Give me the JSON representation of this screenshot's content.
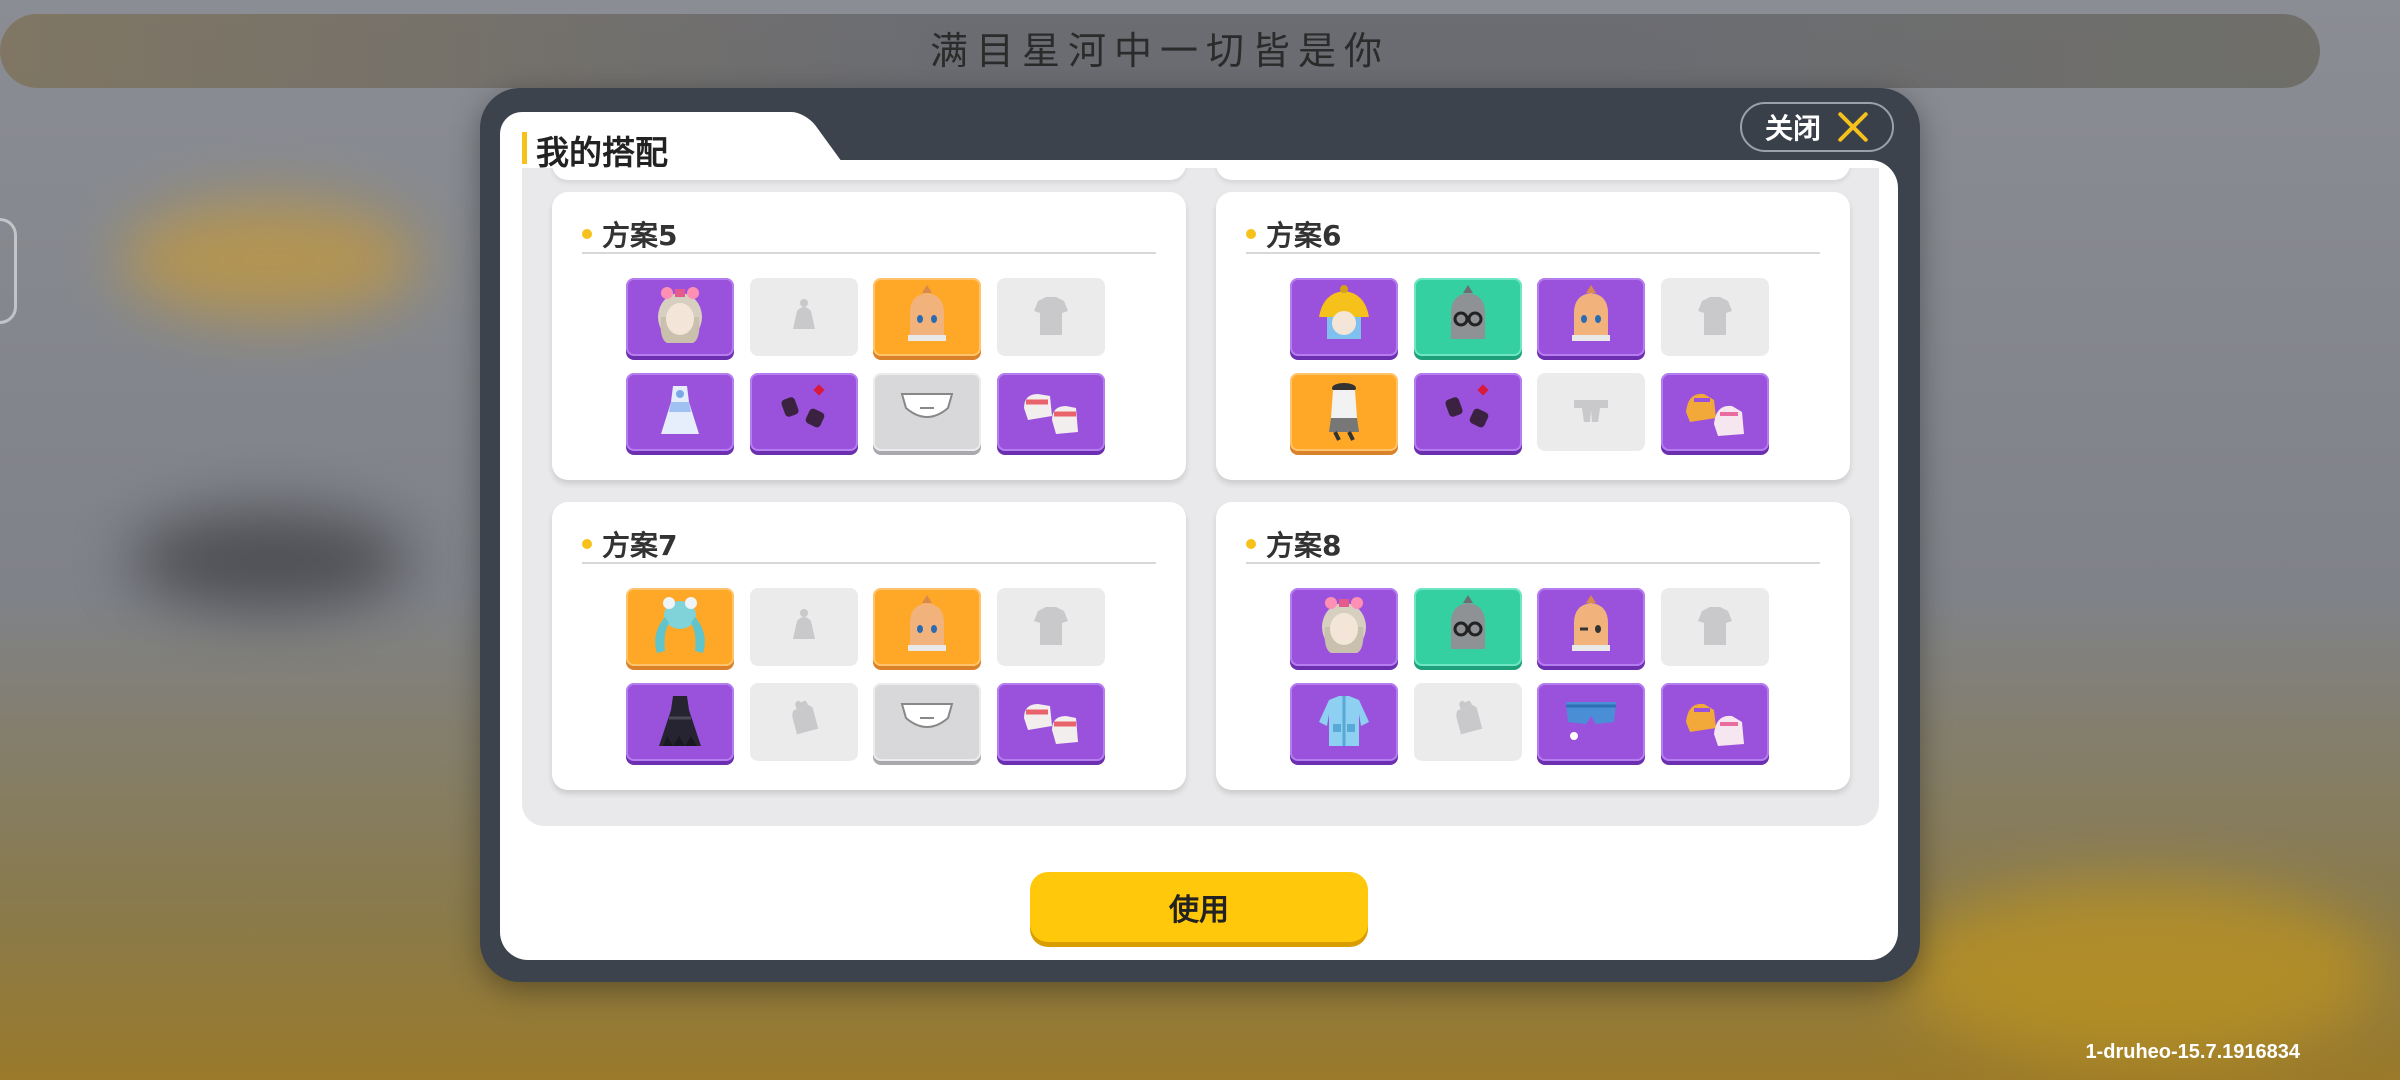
{
  "banner": {
    "text": "满目星河中一切皆是你"
  },
  "dialog": {
    "title": "我的搭配",
    "close_label": "关闭",
    "use_label": "使用"
  },
  "outfits": [
    {
      "name": "方案5",
      "slots": [
        {
          "type": "hair",
          "rarity": "purple",
          "icon": "hair-bow-icon"
        },
        {
          "type": "hat",
          "rarity": "empty",
          "icon": "hat-placeholder-icon"
        },
        {
          "type": "face",
          "rarity": "orange",
          "icon": "face-icon"
        },
        {
          "type": "top",
          "rarity": "empty",
          "icon": "shirt-placeholder-icon"
        },
        {
          "type": "dress",
          "rarity": "purple",
          "icon": "dress-icon"
        },
        {
          "type": "gloves",
          "rarity": "purple",
          "icon": "gloves-icon"
        },
        {
          "type": "bottom",
          "rarity": "grey",
          "icon": "shorts-icon"
        },
        {
          "type": "shoes",
          "rarity": "purple",
          "icon": "shoes-icon"
        }
      ]
    },
    {
      "name": "方案6",
      "slots": [
        {
          "type": "hair",
          "rarity": "purple",
          "icon": "hair-hat-icon"
        },
        {
          "type": "glasses",
          "rarity": "green",
          "icon": "glasses-icon"
        },
        {
          "type": "face",
          "rarity": "purple",
          "icon": "face-icon"
        },
        {
          "type": "top",
          "rarity": "empty",
          "icon": "shirt-placeholder-icon"
        },
        {
          "type": "outfit",
          "rarity": "orange",
          "icon": "outfit-icon"
        },
        {
          "type": "gloves",
          "rarity": "purple",
          "icon": "gloves-icon"
        },
        {
          "type": "bottom",
          "rarity": "empty",
          "icon": "pants-placeholder-icon"
        },
        {
          "type": "shoes",
          "rarity": "purple",
          "icon": "sneakers-icon"
        }
      ]
    },
    {
      "name": "方案7",
      "slots": [
        {
          "type": "hair",
          "rarity": "orange",
          "icon": "hair-twintail-icon"
        },
        {
          "type": "hat",
          "rarity": "empty",
          "icon": "hat-placeholder-icon"
        },
        {
          "type": "face",
          "rarity": "orange",
          "icon": "face-icon"
        },
        {
          "type": "top",
          "rarity": "empty",
          "icon": "shirt-placeholder-icon"
        },
        {
          "type": "dress",
          "rarity": "purple",
          "icon": "black-dress-icon"
        },
        {
          "type": "gloves",
          "rarity": "empty",
          "icon": "glove-placeholder-icon"
        },
        {
          "type": "bottom",
          "rarity": "grey",
          "icon": "shorts-icon"
        },
        {
          "type": "shoes",
          "rarity": "purple",
          "icon": "shoes-icon"
        }
      ]
    },
    {
      "name": "方案8",
      "slots": [
        {
          "type": "hair",
          "rarity": "purple",
          "icon": "hair-bow-icon"
        },
        {
          "type": "glasses",
          "rarity": "green",
          "icon": "glasses-icon"
        },
        {
          "type": "face",
          "rarity": "purple",
          "icon": "face-wink-icon"
        },
        {
          "type": "top",
          "rarity": "empty",
          "icon": "shirt-placeholder-icon"
        },
        {
          "type": "jacket",
          "rarity": "purple",
          "icon": "jacket-icon"
        },
        {
          "type": "gloves",
          "rarity": "empty",
          "icon": "glove-placeholder-icon"
        },
        {
          "type": "bottom",
          "rarity": "purple",
          "icon": "denim-shorts-icon"
        },
        {
          "type": "shoes",
          "rarity": "purple",
          "icon": "sneakers-icon"
        }
      ]
    }
  ],
  "version": {
    "text": "1-druheo-15.7.1916834"
  },
  "colors": {
    "accent": "#f6c11a",
    "rare_purple": "#9a52dc",
    "rare_orange": "#ffa726",
    "rare_green": "#34d0a2"
  }
}
